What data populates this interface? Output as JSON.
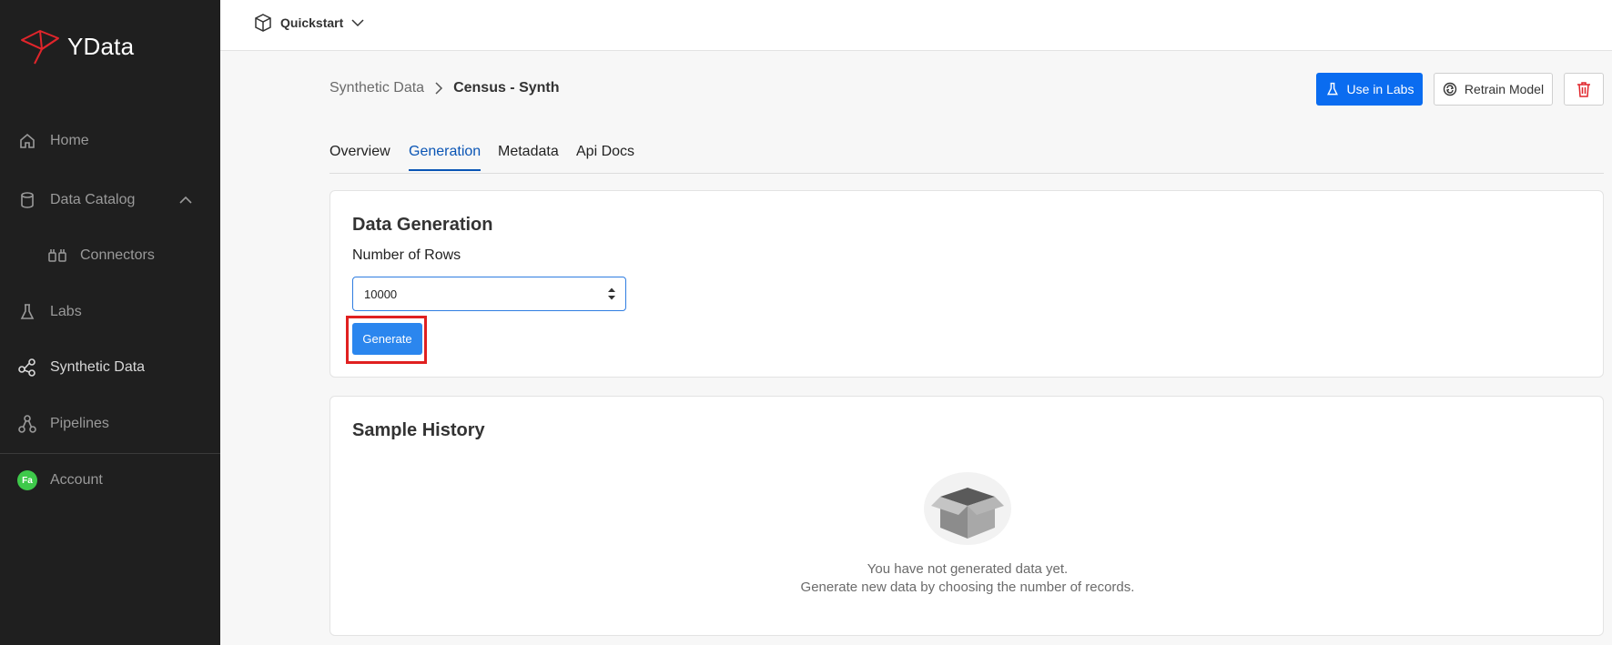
{
  "app": {
    "name": "YData"
  },
  "sidebar": {
    "items": [
      {
        "label": "Home"
      },
      {
        "label": "Data Catalog"
      },
      {
        "label": "Connectors"
      },
      {
        "label": "Labs"
      },
      {
        "label": "Synthetic Data"
      },
      {
        "label": "Pipelines"
      },
      {
        "label": "Account"
      }
    ],
    "avatar_initials": "Fa"
  },
  "topbar": {
    "project": "Quickstart"
  },
  "breadcrumb": {
    "parent": "Synthetic Data",
    "current": "Census - Synth"
  },
  "actions": {
    "use_in_labs": "Use in Labs",
    "retrain": "Retrain Model"
  },
  "tabs": [
    {
      "label": "Overview"
    },
    {
      "label": "Generation",
      "active": true
    },
    {
      "label": "Metadata"
    },
    {
      "label": "Api Docs"
    }
  ],
  "generation": {
    "title": "Data Generation",
    "rows_label": "Number of Rows",
    "rows_value": "10000",
    "generate_label": "Generate"
  },
  "history": {
    "title": "Sample History",
    "empty_line1": "You have not generated data yet.",
    "empty_line2": "Generate new data by choosing the number of records."
  },
  "colors": {
    "sidebar_bg": "#1f1f1f",
    "primary": "#0a6cf0",
    "tab_active": "#0a55b5",
    "logo_red": "#e0252b",
    "highlight": "#e02020"
  }
}
